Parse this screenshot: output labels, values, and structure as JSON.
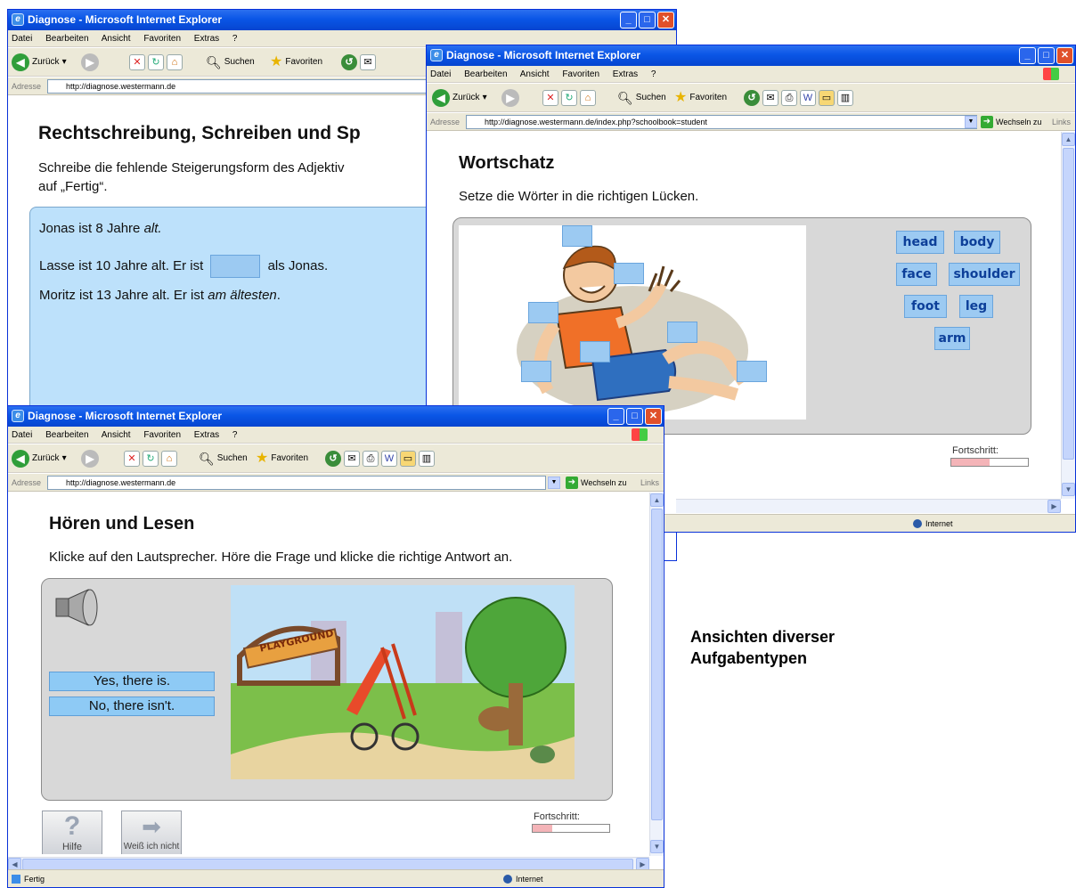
{
  "browser": {
    "window_title": "Diagnose - Microsoft Internet Explorer",
    "menu": [
      "Datei",
      "Bearbeiten",
      "Ansicht",
      "Favoriten",
      "Extras",
      "?"
    ],
    "back_label": "Zurück",
    "search_label": "Suchen",
    "favorites_label": "Favoriten",
    "address_label": "Adresse",
    "go_label": "Wechseln zu",
    "links_label": "Links",
    "status_done": "Fertig",
    "zone_label": "Internet"
  },
  "window1": {
    "url": "http://diagnose.westermann.de",
    "heading": "Rechtschreibung, Schreiben und Sp",
    "instruction_line1": "Schreibe die fehlende Steigerungsform des Adjektiv",
    "instruction_line2": "auf „Fertig“.",
    "sentence1_text": "Jonas ist 8 Jahre ",
    "sentence1_italic": "alt.",
    "sentence2_before": "Lasse ist 10 Jahre alt. Er ist",
    "sentence2_after": "als Jonas.",
    "sentence3_text": "Moritz ist 13 Jahre alt. Er ist ",
    "sentence3_italic": "am ältesten",
    "sentence3_end": "."
  },
  "window2": {
    "url": "http://diagnose.westermann.de/index.php?schoolbook=student",
    "heading": "Wortschatz",
    "instruction": "Setze die Wörter in die richtigen Lücken.",
    "words": [
      "head",
      "body",
      "face",
      "shoulder",
      "foot",
      "leg",
      "arm"
    ],
    "progress_label": "Fortschritt:",
    "progress_value": 0.5
  },
  "window3": {
    "url": "http://diagnose.westermann.de",
    "heading": "Hören und Lesen",
    "instruction": "Klicke auf den Lautsprecher. Höre die Frage und klicke die richtige Antwort an.",
    "answers": [
      "Yes, there is.",
      "No, there isn't."
    ],
    "illustration_sign": "PLAYGROUND",
    "help_label": "Hilfe",
    "skip_label": "Weiß ich nicht",
    "progress_label": "Fortschritt:",
    "progress_value": 0.25
  },
  "caption": {
    "line1": "Ansichten diverser",
    "line2": "Aufgabentypen"
  },
  "colors": {
    "titlebar": "#0a56e6",
    "answer_box": "#9ccaf2",
    "panel": "#d8d8d8",
    "progress_fill": "#f4b4b8"
  }
}
